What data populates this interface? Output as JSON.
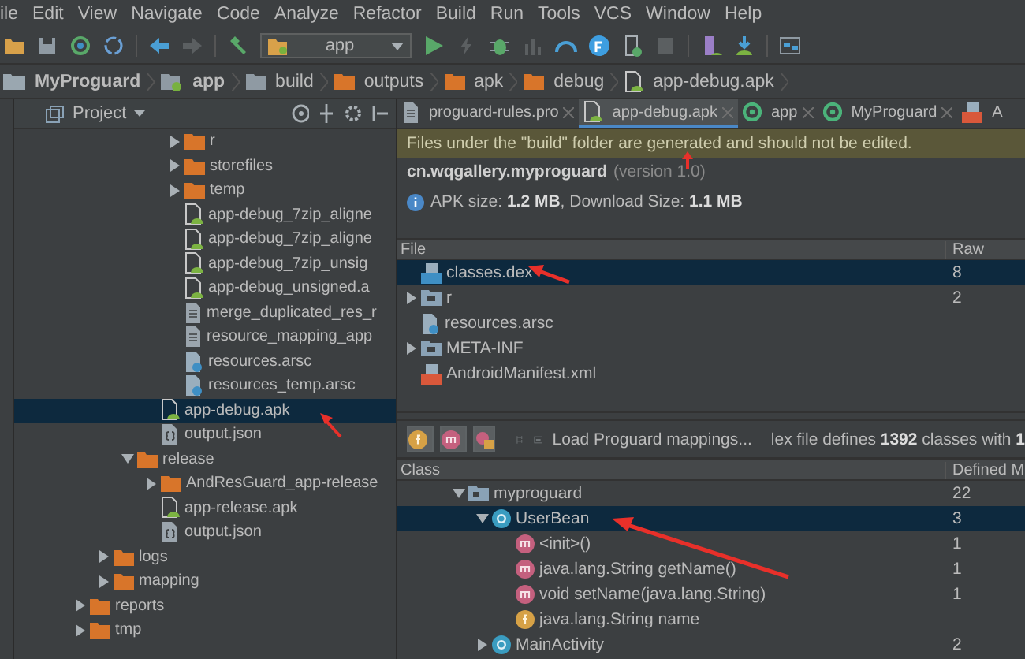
{
  "menu": [
    "ile",
    "Edit",
    "View",
    "Navigate",
    "Code",
    "Analyze",
    "Refactor",
    "Build",
    "Run",
    "Tools",
    "VCS",
    "Window",
    "Help"
  ],
  "toolbar": {
    "config": "app"
  },
  "breadcrumbs": [
    {
      "label": "MyProguard",
      "kind": "project"
    },
    {
      "label": "app",
      "kind": "module"
    },
    {
      "label": "build",
      "kind": "plain_folder"
    },
    {
      "label": "outputs",
      "kind": "folder"
    },
    {
      "label": "apk",
      "kind": "folder"
    },
    {
      "label": "debug",
      "kind": "folder"
    },
    {
      "label": "app-debug.apk",
      "kind": "apk"
    }
  ],
  "project_panel": {
    "title": "Project",
    "tree": [
      {
        "children": [
          {
            "children": [
              {
                "children": [
                  {
                    "children": [
                      {
                        "label": "r",
                        "kind": "folder",
                        "expanded": false,
                        "selected": false
                      },
                      {
                        "label": "storefiles",
                        "kind": "folder",
                        "expanded": false,
                        "selected": false
                      },
                      {
                        "label": "temp",
                        "kind": "folder",
                        "expanded": false,
                        "selected": false
                      },
                      {
                        "label": "app-debug_7zip_aligne",
                        "kind": "apk",
                        "selected": false
                      },
                      {
                        "label": "app-debug_7zip_aligne",
                        "kind": "apk",
                        "selected": false
                      },
                      {
                        "label": "app-debug_7zip_unsig",
                        "kind": "apk",
                        "selected": false
                      },
                      {
                        "label": "app-debug_unsigned.a",
                        "kind": "apk",
                        "selected": false
                      },
                      {
                        "label": "merge_duplicated_res_r",
                        "kind": "text",
                        "selected": false
                      },
                      {
                        "label": "resource_mapping_app",
                        "kind": "text",
                        "selected": false
                      },
                      {
                        "label": "resources.arsc",
                        "kind": "arsc",
                        "selected": false
                      },
                      {
                        "label": "resources_temp.arsc",
                        "kind": "arsc",
                        "selected": false
                      }
                    ]
                  },
                  {
                    "label": "app-debug.apk",
                    "kind": "apk",
                    "selected": true
                  },
                  {
                    "label": "output.json",
                    "kind": "json",
                    "selected": false
                  }
                ]
              },
              {
                "label": "release",
                "kind": "folder",
                "expanded": true,
                "selected": false,
                "children": [
                  {
                    "label": "AndResGuard_app-release",
                    "kind": "folder",
                    "expanded": false,
                    "selected": false
                  },
                  {
                    "label": "app-release.apk",
                    "kind": "apk",
                    "selected": false
                  },
                  {
                    "label": "output.json",
                    "kind": "json",
                    "selected": false
                  }
                ]
              }
            ]
          },
          {
            "label": "logs",
            "kind": "folder",
            "expanded": false,
            "selected": false
          },
          {
            "label": "mapping",
            "kind": "folder",
            "expanded": false,
            "selected": false
          }
        ]
      },
      {
        "label": "reports",
        "kind": "folder",
        "expanded": false,
        "selected": false
      },
      {
        "label": "tmp",
        "kind": "folder",
        "expanded": false,
        "selected": false
      }
    ]
  },
  "editor": {
    "tabs": [
      {
        "label": "proguard-rules.pro",
        "kind": "text",
        "selected": false
      },
      {
        "label": "app-debug.apk",
        "kind": "apk",
        "selected": true
      },
      {
        "label": "app",
        "kind": "gradle",
        "selected": false
      },
      {
        "label": "MyProguard",
        "kind": "gradle",
        "selected": false
      },
      {
        "label": "A",
        "kind": "xml",
        "selected": false
      }
    ],
    "warning": "Files under the \"build\" folder are generated and should not be edited.",
    "app_id": "cn.wqgallery.myproguard",
    "version": "(version 1.0)",
    "apk_size": "APK size: **1.2 MB**, Download Size: **1.1 MB**",
    "files_table": {
      "columns": [
        "File",
        "Raw"
      ],
      "rows": [
        {
          "label": "classes.dex",
          "kind": "dex",
          "selected": true,
          "raw": "8"
        },
        {
          "label": "r",
          "kind": "dir",
          "expanded": false,
          "selected": false,
          "raw": "2"
        },
        {
          "label": "resources.arsc",
          "kind": "arsc",
          "selected": false
        },
        {
          "label": "META-INF",
          "kind": "dir",
          "expanded": false,
          "selected": false
        },
        {
          "label": "AndroidManifest.xml",
          "kind": "xml",
          "selected": false
        }
      ]
    },
    "class_toolbar": {
      "load_mappings": "Load Proguard mappings...",
      "summary": "lex file defines **1392** classes with **1**"
    },
    "class_table": {
      "columns": [
        "Class",
        "Defined M"
      ],
      "rows": [
        {
          "label": "myproguard",
          "kind": "package",
          "expanded": true,
          "selected": false,
          "count": "22",
          "children": [
            {
              "label": "UserBean",
              "kind": "class",
              "expanded": true,
              "selected": true,
              "count": "3",
              "children": [
                {
                  "label": "<init>()",
                  "kind": "method",
                  "selected": false,
                  "count": "1"
                },
                {
                  "label": "java.lang.String getName()",
                  "kind": "method",
                  "selected": false,
                  "count": "1"
                },
                {
                  "label": "void setName(java.lang.String)",
                  "kind": "method",
                  "selected": false,
                  "count": "1"
                },
                {
                  "label": "java.lang.String name",
                  "kind": "field",
                  "selected": false
                }
              ]
            },
            {
              "label": "MainActivity",
              "kind": "class",
              "expanded": false,
              "selected": false,
              "count": "2"
            }
          ]
        }
      ]
    }
  }
}
